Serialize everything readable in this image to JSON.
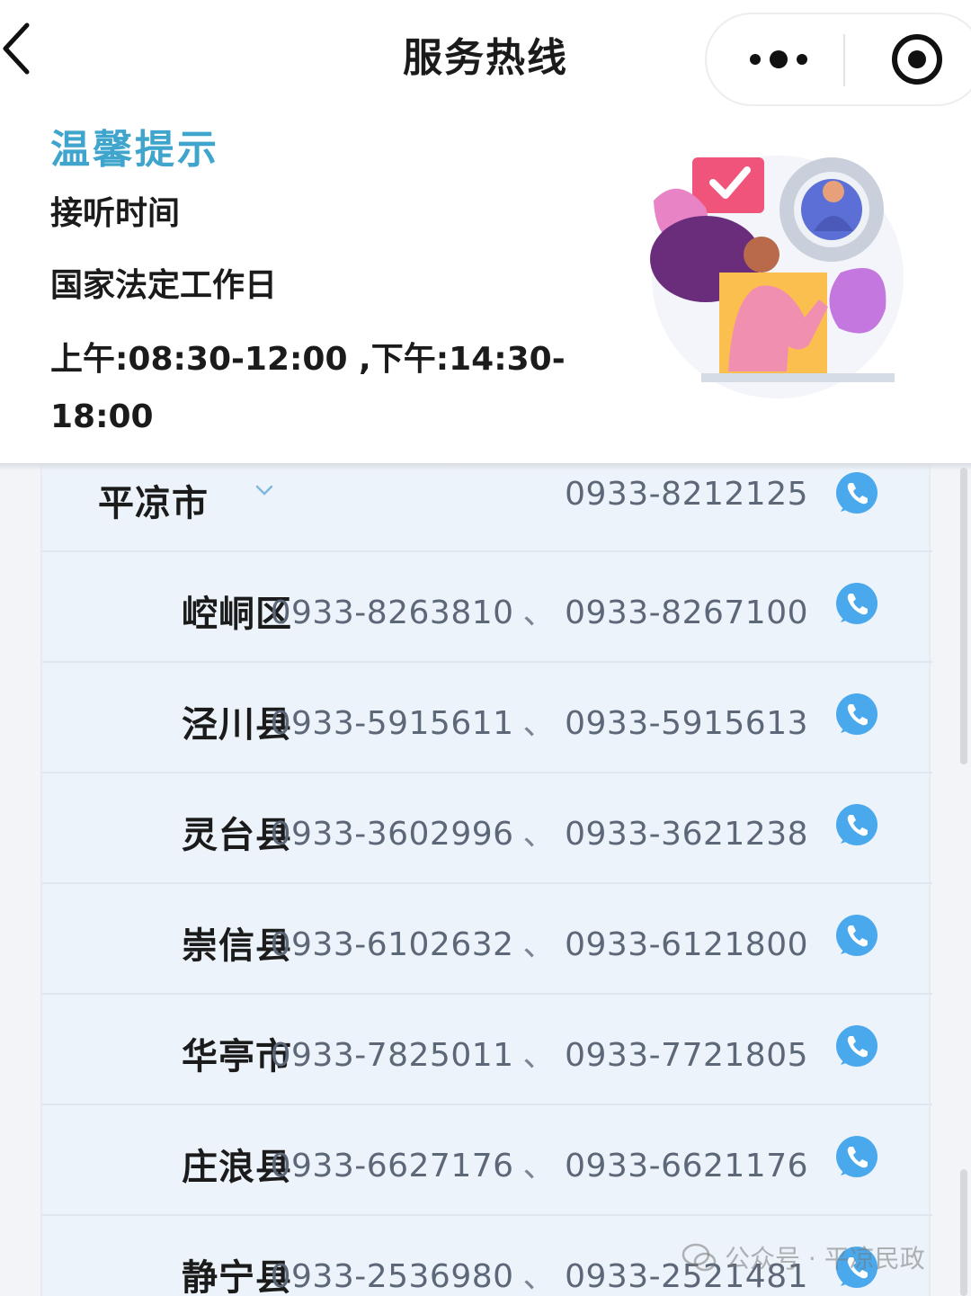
{
  "navbar": {
    "title": "服务热线",
    "back_icon": "chevron-left-icon",
    "more_icon": "more-dots-icon",
    "close_icon": "target-circle-icon"
  },
  "tip": {
    "title": "温馨提示",
    "line1": "接听时间",
    "line2": "国家法定工作日",
    "line3": "上午:08:30-12:00 ,下午:14:30-18:00",
    "illustration": "customer-service-illustration"
  },
  "list": {
    "header": {
      "name": "平凉市",
      "phone": "0933-8212125",
      "expand_icon": "chevron-down-icon"
    },
    "separator": "、",
    "items": [
      {
        "name": "崆峒区",
        "phone1": "0933-8263810",
        "phone2": "0933-8267100"
      },
      {
        "name": "泾川县",
        "phone1": "0933-5915611",
        "phone2": "0933-5915613"
      },
      {
        "name": "灵台县",
        "phone1": "0933-3602996",
        "phone2": "0933-3621238"
      },
      {
        "name": "崇信县",
        "phone1": "0933-6102632",
        "phone2": "0933-6121800"
      },
      {
        "name": "华亭市",
        "phone1": "0933-7825011",
        "phone2": "0933-7721805"
      },
      {
        "name": "庄浪县",
        "phone1": "0933-6627176",
        "phone2": "0933-6621176"
      },
      {
        "name": "静宁县",
        "phone1": "0933-2536980",
        "phone2": "0933-2521481"
      }
    ],
    "call_icon": "phone-call-icon"
  },
  "watermark": {
    "text": "公众号 · 平凉民政"
  },
  "colors": {
    "accent": "#3fa5cc",
    "call_blue": "#4aa9ec",
    "list_bg": "#edf3fa"
  }
}
